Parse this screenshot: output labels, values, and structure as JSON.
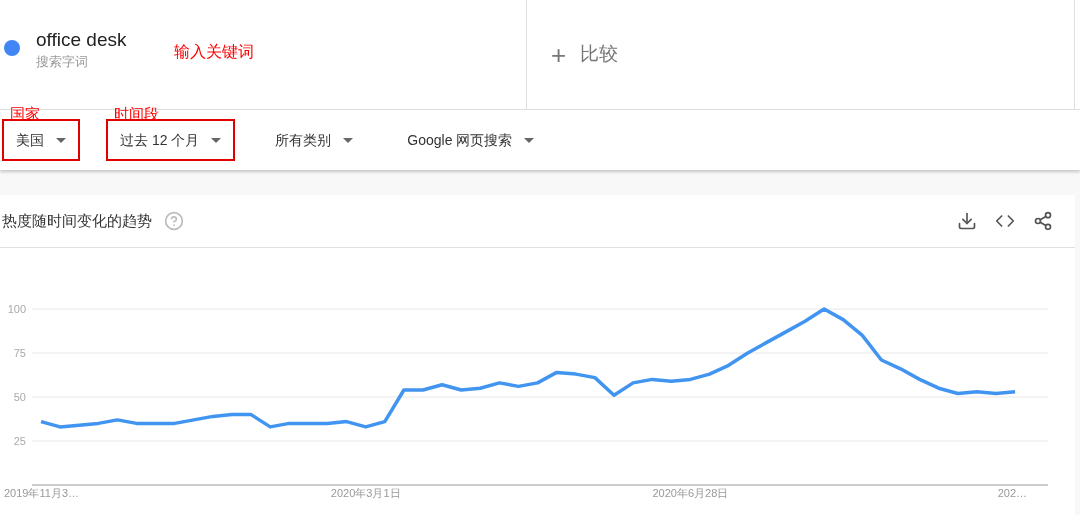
{
  "keyword": {
    "term": "office desk",
    "subtitle": "搜索字词",
    "color": "#4285f4",
    "annotation": "输入关键词"
  },
  "compare": {
    "icon": "+",
    "label": "比较"
  },
  "filters": [
    {
      "label": "美国",
      "highlighted": true,
      "annotation": "国家"
    },
    {
      "label": "过去 12 个月",
      "highlighted": true,
      "annotation": "时间段"
    },
    {
      "label": "所有类别",
      "highlighted": false
    },
    {
      "label": "Google 网页搜索",
      "highlighted": false
    }
  ],
  "trend_card": {
    "title": "热度随时间变化的趋势",
    "chart_data": {
      "type": "line",
      "grid": true,
      "ylim": [
        0,
        100
      ],
      "yticks": [
        25,
        50,
        75,
        100
      ],
      "categories": [
        "2019年11月3…",
        null,
        null,
        null,
        null,
        null,
        null,
        null,
        null,
        null,
        null,
        null,
        null,
        null,
        null,
        null,
        null,
        "2020年3月1日",
        null,
        null,
        null,
        null,
        null,
        null,
        null,
        null,
        null,
        null,
        null,
        null,
        null,
        null,
        null,
        null,
        "2020年6月28日",
        null,
        null,
        null,
        null,
        null,
        null,
        null,
        null,
        null,
        null,
        null,
        null,
        null,
        null,
        null,
        null,
        "202…"
      ],
      "series": [
        {
          "color": "#4195f0",
          "values": [
            36,
            33,
            34,
            35,
            37,
            35,
            35,
            35,
            37,
            39,
            40,
            40,
            33,
            35,
            35,
            35,
            36,
            33,
            36,
            54,
            54,
            57,
            54,
            55,
            58,
            56,
            58,
            64,
            63,
            61,
            51,
            58,
            60,
            59,
            60,
            63,
            68,
            75,
            81,
            87,
            93,
            100,
            94,
            85,
            71,
            66,
            60,
            55,
            52,
            53,
            52,
            53
          ]
        }
      ]
    }
  }
}
